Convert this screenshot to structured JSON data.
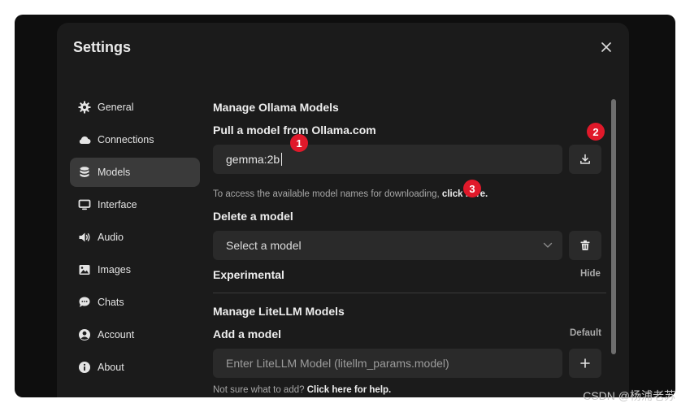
{
  "modal": {
    "title": "Settings"
  },
  "sidebar": {
    "items": [
      {
        "label": "General",
        "icon": "gear-icon"
      },
      {
        "label": "Connections",
        "icon": "cloud-icon"
      },
      {
        "label": "Models",
        "icon": "database-icon",
        "active": true
      },
      {
        "label": "Interface",
        "icon": "monitor-icon"
      },
      {
        "label": "Audio",
        "icon": "speaker-icon"
      },
      {
        "label": "Images",
        "icon": "image-icon"
      },
      {
        "label": "Chats",
        "icon": "chat-bubble-icon"
      },
      {
        "label": "Account",
        "icon": "user-circle-icon"
      },
      {
        "label": "About",
        "icon": "info-icon"
      }
    ]
  },
  "ollama": {
    "heading": "Manage Ollama Models",
    "pull_label": "Pull a model from Ollama.com",
    "pull_value": "gemma:2b",
    "access_hint": "To access the available model names for downloading,",
    "access_link": "click here.",
    "delete_label": "Delete a model",
    "select_placeholder": "Select a model",
    "experimental_label": "Experimental",
    "hide_label": "Hide"
  },
  "litellm": {
    "heading": "Manage LiteLLM Models",
    "add_label": "Add a model",
    "default_label": "Default",
    "input_placeholder": "Enter LiteLLM Model (litellm_params.model)",
    "help_hint": "Not sure what to add?",
    "help_link": "Click here for help."
  },
  "annotations": {
    "badge1": "1",
    "badge2": "2",
    "badge3": "3"
  },
  "watermark": "CSDN @杨浦老苏",
  "colors": {
    "badge": "#e0192a",
    "modal_bg": "#1b1b1b",
    "field_bg": "#2a2a2a",
    "active_item": "#3a3a3a"
  }
}
